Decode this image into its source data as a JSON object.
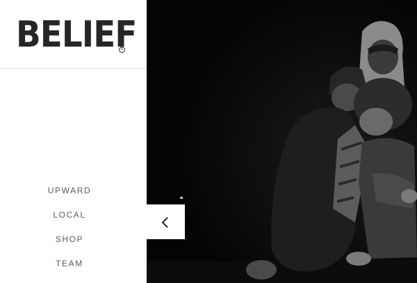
{
  "brand": {
    "logo_text": "BELIEF",
    "registered_mark": "®"
  },
  "nav": {
    "items": [
      {
        "label": "UPWARD"
      },
      {
        "label": "LOCAL"
      },
      {
        "label": "SHOP"
      },
      {
        "label": "TEAM"
      }
    ]
  },
  "hero": {
    "image_description": "black-and-white night photo of a group of people in hooded jackets",
    "prev_icon": "chevron-left-icon"
  },
  "colors": {
    "logo": "#262626",
    "nav_text": "#5a5a5a",
    "hero_background": "#050505",
    "divider": "#dcdcdc"
  }
}
